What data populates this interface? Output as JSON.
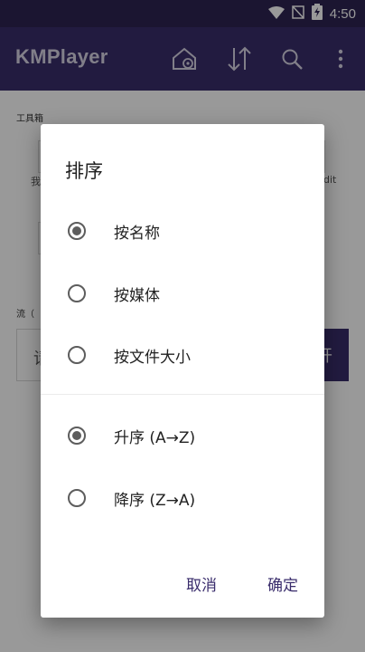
{
  "status_bar": {
    "time": "4:50",
    "icons": [
      "wifi-icon",
      "signal-off-icon",
      "battery-charging-icon"
    ]
  },
  "app_bar": {
    "title": "KMPlayer",
    "actions": [
      "home-settings-icon",
      "sort-icon",
      "search-icon",
      "more-vert-icon"
    ]
  },
  "background": {
    "toolbox_label": "工具箱",
    "fragment_left": "我",
    "fragment_right": "dit",
    "stream_label": "流（",
    "input_fragment": "请",
    "button_fragment": "开"
  },
  "sort_dialog": {
    "title": "排序",
    "sort_by_options": [
      {
        "label": "按名称",
        "checked": true
      },
      {
        "label": "按媒体",
        "checked": false
      },
      {
        "label": "按文件大小",
        "checked": false
      }
    ],
    "order_options": [
      {
        "label": "升序 (A→Z)",
        "checked": true
      },
      {
        "label": "降序 (Z→A)",
        "checked": false
      }
    ],
    "cancel_label": "取消",
    "confirm_label": "确定"
  },
  "colors": {
    "primary": "#3a2d6c",
    "status_bar": "#2e2453",
    "radio": "#5d5d5d"
  }
}
